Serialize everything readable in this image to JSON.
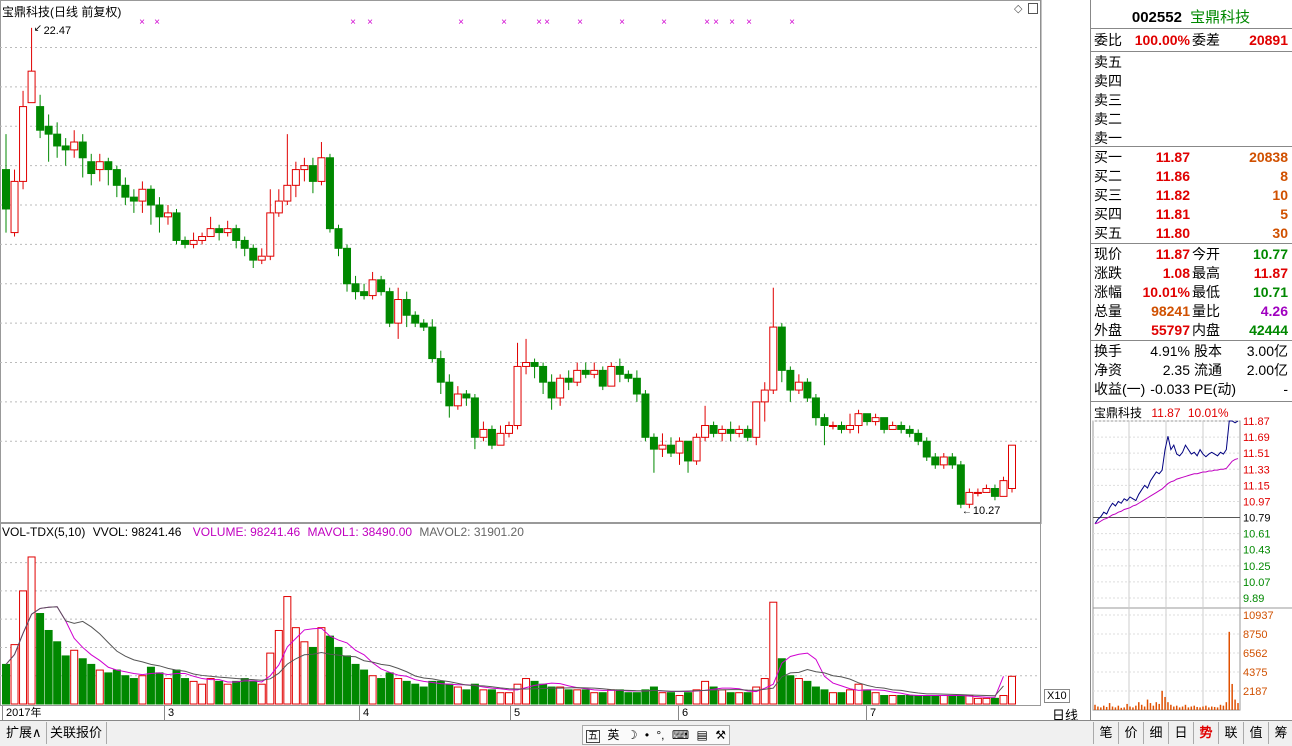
{
  "chart_header": {
    "title": "宝鼎科技(日线 前复权)",
    "high_label": "22.47",
    "low_label": "10.27"
  },
  "vol_header": {
    "name": "VOL-TDX(5,10)",
    "vvol": "VVOL: 98241.46",
    "volume": "VOLUME: 98241.46",
    "mavol1": "MAVOL1: 38490.00",
    "mavol2": "MAVOL2: 31901.20"
  },
  "axis": {
    "price_ticks": [
      "22.00",
      "21.00",
      "20.00",
      "19.00",
      "18.00",
      "17.00",
      "16.00",
      "15.00",
      "14.00",
      "13.00",
      "12.00"
    ],
    "vol_ticks": [
      "50000",
      "40000",
      "30000",
      "20000",
      "10000"
    ],
    "vol_unit": "X10",
    "dates": [
      "2017年",
      "3",
      "4",
      "5",
      "6",
      "7"
    ],
    "period": "日线"
  },
  "chart_data": {
    "type": "candlestick",
    "ylim": [
      10.0,
      22.75
    ],
    "volume_ylim": [
      0,
      58000
    ],
    "candles": [
      [
        18.9,
        17.9,
        19.8,
        17.3,
        14000
      ],
      [
        17.3,
        18.6,
        18.9,
        17.2,
        21000
      ],
      [
        18.6,
        20.5,
        20.9,
        18.4,
        40000
      ],
      [
        20.6,
        21.4,
        22.5,
        20.7,
        52000
      ],
      [
        20.5,
        19.9,
        20.8,
        19.7,
        32000
      ],
      [
        20.0,
        19.8,
        20.3,
        19.1,
        26000
      ],
      [
        19.8,
        19.5,
        20.1,
        19.2,
        22000
      ],
      [
        19.5,
        19.4,
        19.7,
        19.0,
        17000
      ],
      [
        19.4,
        19.6,
        19.9,
        19.2,
        19000
      ],
      [
        19.6,
        19.2,
        19.8,
        18.7,
        16000
      ],
      [
        19.1,
        18.8,
        19.3,
        18.5,
        14000
      ],
      [
        18.9,
        19.1,
        19.3,
        18.6,
        12000
      ],
      [
        19.1,
        18.9,
        19.2,
        18.5,
        11000
      ],
      [
        18.9,
        18.5,
        19.0,
        18.2,
        12000
      ],
      [
        18.5,
        18.2,
        18.7,
        18.0,
        10000
      ],
      [
        18.2,
        18.1,
        18.4,
        17.8,
        9000
      ],
      [
        18.1,
        18.4,
        18.6,
        17.8,
        10000
      ],
      [
        18.4,
        18.0,
        18.5,
        17.5,
        13000
      ],
      [
        18.0,
        17.7,
        18.2,
        17.3,
        11000
      ],
      [
        17.7,
        17.8,
        18.0,
        17.5,
        9000
      ],
      [
        17.8,
        17.1,
        17.9,
        17.0,
        12000
      ],
      [
        17.1,
        17.0,
        17.2,
        16.9,
        9000
      ],
      [
        17.0,
        17.1,
        17.3,
        16.9,
        8000
      ],
      [
        17.1,
        17.2,
        17.3,
        17.0,
        7000
      ],
      [
        17.2,
        17.4,
        17.7,
        17.2,
        9000
      ],
      [
        17.4,
        17.3,
        17.5,
        17.1,
        8000
      ],
      [
        17.3,
        17.4,
        17.6,
        17.2,
        7000
      ],
      [
        17.4,
        17.1,
        17.5,
        16.9,
        8000
      ],
      [
        17.1,
        16.9,
        17.2,
        16.7,
        9000
      ],
      [
        16.9,
        16.6,
        17.0,
        16.4,
        8000
      ],
      [
        16.6,
        16.7,
        16.9,
        16.5,
        7000
      ],
      [
        16.7,
        17.8,
        18.4,
        16.6,
        18000
      ],
      [
        17.8,
        18.1,
        18.4,
        17.7,
        26000
      ],
      [
        18.1,
        18.5,
        19.8,
        18.0,
        38000
      ],
      [
        18.5,
        18.9,
        19.1,
        18.2,
        27000
      ],
      [
        18.9,
        19.0,
        19.2,
        18.6,
        22000
      ],
      [
        19.0,
        18.6,
        19.2,
        18.3,
        20000
      ],
      [
        18.6,
        19.2,
        19.6,
        18.5,
        27000
      ],
      [
        19.2,
        17.4,
        19.3,
        17.3,
        24000
      ],
      [
        17.4,
        16.9,
        17.5,
        16.7,
        20000
      ],
      [
        16.9,
        16.0,
        17.0,
        15.8,
        17000
      ],
      [
        16.0,
        15.8,
        16.2,
        15.6,
        14000
      ],
      [
        15.8,
        15.7,
        16.0,
        15.6,
        12000
      ],
      [
        15.7,
        16.1,
        16.3,
        15.6,
        10000
      ],
      [
        16.1,
        15.8,
        16.2,
        15.7,
        9000
      ],
      [
        15.8,
        15.0,
        15.9,
        14.9,
        11000
      ],
      [
        15.0,
        15.6,
        15.9,
        14.6,
        9000
      ],
      [
        15.6,
        15.2,
        15.8,
        14.9,
        8000
      ],
      [
        15.2,
        15.0,
        15.3,
        14.9,
        7000
      ],
      [
        15.0,
        14.9,
        15.1,
        14.8,
        6000
      ],
      [
        14.9,
        14.1,
        15.1,
        14.0,
        8000
      ],
      [
        14.1,
        13.5,
        14.3,
        13.2,
        8000
      ],
      [
        13.5,
        12.9,
        13.7,
        12.6,
        7000
      ],
      [
        12.9,
        13.2,
        13.4,
        12.8,
        6000
      ],
      [
        13.2,
        13.1,
        13.3,
        12.9,
        5000
      ],
      [
        13.1,
        12.1,
        13.2,
        11.8,
        7000
      ],
      [
        12.1,
        12.3,
        12.5,
        12.0,
        5000
      ],
      [
        12.3,
        11.9,
        12.4,
        11.8,
        5000
      ],
      [
        11.9,
        12.2,
        12.4,
        11.9,
        4000
      ],
      [
        12.2,
        12.4,
        12.5,
        12.1,
        4000
      ],
      [
        12.4,
        13.9,
        14.5,
        12.3,
        7000
      ],
      [
        13.9,
        14.0,
        14.6,
        13.7,
        9000
      ],
      [
        14.0,
        13.9,
        14.1,
        13.6,
        8000
      ],
      [
        13.9,
        13.5,
        14.0,
        13.2,
        7000
      ],
      [
        13.5,
        13.1,
        13.7,
        12.8,
        6000
      ],
      [
        13.1,
        13.6,
        13.7,
        12.9,
        6000
      ],
      [
        13.6,
        13.5,
        13.8,
        13.3,
        5000
      ],
      [
        13.5,
        13.8,
        14.0,
        13.4,
        5000
      ],
      [
        13.8,
        13.7,
        14.0,
        13.6,
        5000
      ],
      [
        13.7,
        13.8,
        14.0,
        13.6,
        4000
      ],
      [
        13.8,
        13.4,
        13.9,
        13.3,
        4000
      ],
      [
        13.4,
        13.9,
        14.0,
        13.4,
        5000
      ],
      [
        13.9,
        13.7,
        14.1,
        13.5,
        5000
      ],
      [
        13.7,
        13.6,
        13.8,
        13.5,
        4000
      ],
      [
        13.6,
        13.2,
        13.8,
        13.0,
        4000
      ],
      [
        13.2,
        12.1,
        13.3,
        12.0,
        5000
      ],
      [
        12.1,
        11.8,
        12.2,
        11.2,
        6000
      ],
      [
        11.8,
        11.9,
        12.2,
        11.6,
        4000
      ],
      [
        11.9,
        11.7,
        12.1,
        11.6,
        4000
      ],
      [
        11.7,
        12.0,
        12.1,
        11.4,
        3000
      ],
      [
        12.0,
        11.5,
        12.0,
        11.2,
        4000
      ],
      [
        11.5,
        12.1,
        12.2,
        11.4,
        5000
      ],
      [
        12.1,
        12.4,
        12.9,
        12.0,
        8000
      ],
      [
        12.4,
        12.2,
        12.5,
        12.1,
        6000
      ],
      [
        12.2,
        12.3,
        12.4,
        12.0,
        5000
      ],
      [
        12.3,
        12.2,
        12.5,
        12.0,
        4000
      ],
      [
        12.2,
        12.3,
        12.4,
        12.1,
        4000
      ],
      [
        12.3,
        12.1,
        12.4,
        12.0,
        4000
      ],
      [
        12.1,
        13.0,
        13.0,
        11.9,
        6000
      ],
      [
        13.0,
        13.3,
        13.5,
        12.5,
        9000
      ],
      [
        13.3,
        14.9,
        15.9,
        13.2,
        36000
      ],
      [
        14.9,
        13.8,
        15.0,
        13.5,
        16000
      ],
      [
        13.8,
        13.3,
        13.9,
        13.0,
        10000
      ],
      [
        13.3,
        13.5,
        13.7,
        13.2,
        9000
      ],
      [
        13.5,
        13.1,
        13.6,
        13.0,
        8000
      ],
      [
        13.1,
        12.6,
        13.2,
        12.4,
        6000
      ],
      [
        12.6,
        12.4,
        12.7,
        11.9,
        5000
      ],
      [
        12.4,
        12.4,
        12.5,
        12.3,
        4000
      ],
      [
        12.4,
        12.3,
        12.5,
        12.2,
        4000
      ],
      [
        12.3,
        12.4,
        12.7,
        12.2,
        5000
      ],
      [
        12.4,
        12.7,
        12.8,
        12.2,
        7000
      ],
      [
        12.7,
        12.5,
        12.7,
        12.4,
        5000
      ],
      [
        12.5,
        12.6,
        12.7,
        12.4,
        4000
      ],
      [
        12.6,
        12.3,
        12.6,
        12.2,
        3000
      ],
      [
        12.3,
        12.4,
        12.5,
        12.3,
        3000
      ],
      [
        12.4,
        12.3,
        12.5,
        12.2,
        3000
      ],
      [
        12.3,
        12.2,
        12.4,
        12.1,
        3000
      ],
      [
        12.2,
        12.0,
        12.3,
        11.9,
        3000
      ],
      [
        12.0,
        11.6,
        12.1,
        11.5,
        3000
      ],
      [
        11.6,
        11.4,
        11.7,
        11.3,
        3000
      ],
      [
        11.4,
        11.6,
        11.7,
        11.3,
        3000
      ],
      [
        11.6,
        11.4,
        11.7,
        11.3,
        3000
      ],
      [
        11.4,
        10.4,
        11.5,
        10.3,
        3000
      ],
      [
        10.4,
        10.7,
        10.8,
        10.3,
        3000
      ],
      [
        10.7,
        10.7,
        10.8,
        10.6,
        2000
      ],
      [
        10.7,
        10.8,
        10.9,
        10.7,
        2000
      ],
      [
        10.8,
        10.6,
        10.9,
        10.5,
        2000
      ],
      [
        10.6,
        11.0,
        11.1,
        10.6,
        3000
      ],
      [
        10.8,
        11.9,
        11.9,
        10.7,
        9800
      ]
    ],
    "mavol1": [
      14000,
      17500,
      25000,
      31750,
      33800,
      34200,
      34400,
      29400,
      23200,
      20000,
      17400,
      15400,
      13000,
      12000,
      11400,
      10800,
      10400,
      10800,
      11000,
      10400,
      10800,
      10800,
      9800,
      9000,
      8600,
      8600,
      7800,
      7800,
      8200,
      8200,
      7800,
      10000,
      13800,
      20200,
      23200,
      26200,
      26600,
      26800,
      24000,
      22600,
      21600,
      19000,
      17400,
      14600,
      12400,
      11200,
      10200,
      9800,
      8600,
      8000,
      7600,
      7200,
      7000,
      6800,
      6800,
      6600,
      6000,
      5600,
      5400,
      5000,
      5000,
      5800,
      6600,
      7000,
      7400,
      7200,
      6400,
      5800,
      5400,
      5000,
      4800,
      4800,
      4800,
      4600,
      4600,
      4600,
      4800,
      4600,
      4400,
      4400,
      4400,
      4600,
      4800,
      5200,
      5600,
      5600,
      5400,
      4600,
      4400,
      5600,
      7000,
      14400,
      16800,
      17600,
      18000,
      15800,
      9800,
      7400,
      6400,
      5400,
      4800,
      5000,
      5000,
      4800,
      4200,
      3800,
      3200,
      3000,
      3000,
      3000,
      3000,
      3000,
      3000,
      2800,
      2600,
      2400,
      2400,
      9800
    ],
    "mavol2": [
      14000,
      17500,
      25000,
      31750,
      33800,
      34200,
      34400,
      29400,
      28500,
      29200,
      27300,
      24800,
      21700,
      18700,
      16900,
      15600,
      14900,
      14000,
      13500,
      12600,
      12000,
      11600,
      10600,
      10100,
      9800,
      9500,
      9300,
      9000,
      8800,
      8600,
      8400,
      8900,
      10900,
      14100,
      16000,
      17400,
      17600,
      18200,
      17600,
      17300,
      16900,
      16700,
      15300,
      14800,
      14000,
      13600,
      12600,
      11400,
      9900,
      9200,
      8900,
      8300,
      7900,
      7300,
      6700,
      6500,
      6400,
      6100,
      5700,
      5400,
      5300,
      5300,
      5400,
      5500,
      5600,
      5600,
      5700,
      5800,
      5700,
      5600,
      5400,
      5100,
      4900,
      4800,
      4700,
      4700,
      4800,
      4700,
      4500,
      4500,
      4600,
      4700,
      4800,
      4900,
      5000,
      5100,
      5100,
      4900,
      4800,
      5200,
      5600,
      9600,
      11000,
      11200,
      12200,
      11400,
      11000,
      10000,
      9600,
      8800,
      7500,
      6600,
      5900,
      5600,
      5000,
      4800,
      4300,
      3900,
      3600,
      3600,
      3500,
      3400,
      3300,
      3200,
      3100,
      3000,
      2900,
      6400
    ]
  },
  "marks_x": [
    142,
    157,
    353,
    370,
    461,
    504,
    539,
    547,
    580,
    622,
    664,
    707,
    716,
    732,
    749,
    792
  ],
  "right_panel": {
    "code": "002552",
    "name": "宝鼎科技",
    "weibi_label": "委比",
    "weibi_value": "100.00%",
    "weicha_label": "委差",
    "weicha_value": "20891",
    "sells": [
      {
        "label": "卖五",
        "price": "",
        "vol": ""
      },
      {
        "label": "卖四",
        "price": "",
        "vol": ""
      },
      {
        "label": "卖三",
        "price": "",
        "vol": ""
      },
      {
        "label": "卖二",
        "price": "",
        "vol": ""
      },
      {
        "label": "卖一",
        "price": "",
        "vol": ""
      }
    ],
    "buys": [
      {
        "label": "买一",
        "price": "11.87",
        "vol": "20838"
      },
      {
        "label": "买二",
        "price": "11.86",
        "vol": "8"
      },
      {
        "label": "买三",
        "price": "11.82",
        "vol": "10"
      },
      {
        "label": "买四",
        "price": "11.81",
        "vol": "5"
      },
      {
        "label": "买五",
        "price": "11.80",
        "vol": "30"
      }
    ],
    "stats": [
      {
        "l1": "现价",
        "v1": "11.87",
        "c1": "red",
        "l2": "今开",
        "v2": "10.77",
        "c2": "green"
      },
      {
        "l1": "涨跌",
        "v1": "1.08",
        "c1": "red",
        "l2": "最高",
        "v2": "11.87",
        "c2": "red"
      },
      {
        "l1": "涨幅",
        "v1": "10.01%",
        "c1": "red",
        "l2": "最低",
        "v2": "10.71",
        "c2": "green"
      },
      {
        "l1": "总量",
        "v1": "98241",
        "c1": "orange",
        "l2": "量比",
        "v2": "4.26",
        "c2": "purple"
      },
      {
        "l1": "外盘",
        "v1": "55797",
        "c1": "red",
        "l2": "内盘",
        "v2": "42444",
        "c2": "green"
      }
    ],
    "fund": [
      {
        "l1": "换手",
        "v1": "4.91%",
        "l2": "股本",
        "v2": "3.00亿"
      },
      {
        "l1": "净资",
        "v1": "2.35",
        "l2": "流通",
        "v2": "2.00亿"
      },
      {
        "l1": "收益(一)",
        "v1": "-0.033",
        "l2": "PE(动)",
        "v2": "-"
      }
    ]
  },
  "intraday": {
    "name": "宝鼎科技",
    "price": "11.87",
    "pct": "10.01%",
    "price_ticks": [
      "11.87",
      "11.69",
      "11.51",
      "11.33",
      "11.15",
      "10.97",
      "10.79",
      "10.61",
      "10.43",
      "10.25",
      "10.07",
      "9.89"
    ],
    "vol_ticks": [
      "10937",
      "8750",
      "6562",
      "4375",
      "2187"
    ],
    "prices": [
      10.72,
      10.77,
      10.8,
      10.85,
      10.83,
      10.9,
      10.95,
      10.92,
      10.97,
      10.95,
      11.0,
      10.98,
      11.02,
      11.0,
      10.98,
      11.05,
      11.1,
      11.15,
      11.12,
      11.2,
      11.25,
      11.3,
      11.28,
      11.32,
      11.55,
      11.7,
      11.55,
      11.6,
      11.5,
      11.48,
      11.52,
      11.6,
      11.55,
      11.5,
      11.52,
      11.48,
      11.55,
      11.5,
      11.47,
      11.5,
      11.52,
      11.5,
      11.48,
      11.52,
      11.5,
      11.55,
      11.87,
      11.87,
      11.85,
      11.87
    ],
    "avg": [
      10.72,
      10.73,
      10.75,
      10.77,
      10.78,
      10.8,
      10.82,
      10.83,
      10.85,
      10.86,
      10.88,
      10.89,
      10.9,
      10.92,
      10.93,
      10.95,
      10.97,
      10.99,
      11.01,
      11.03,
      11.05,
      11.07,
      11.09,
      11.11,
      11.14,
      11.17,
      11.19,
      11.2,
      11.22,
      11.23,
      11.24,
      11.25,
      11.26,
      11.27,
      11.28,
      11.28,
      11.29,
      11.3,
      11.3,
      11.31,
      11.31,
      11.32,
      11.32,
      11.33,
      11.33,
      11.34,
      11.38,
      11.42,
      11.44,
      11.45
    ],
    "vols": [
      600,
      400,
      300,
      500,
      350,
      800,
      400,
      300,
      500,
      250,
      300,
      700,
      400,
      300,
      500,
      900,
      600,
      400,
      1200,
      800,
      500,
      900,
      700,
      2200,
      1500,
      900,
      600,
      400,
      500,
      300,
      400,
      600,
      300,
      400,
      500,
      350,
      300,
      400,
      500,
      300,
      400,
      350,
      300,
      600,
      500,
      900,
      9000,
      3000,
      1200,
      800
    ]
  },
  "bottom_tabs": {
    "left": [
      "扩展∧",
      "关联报价"
    ],
    "right": [
      "笔",
      "价",
      "细",
      "日",
      "势",
      "联",
      "值",
      "筹"
    ]
  }
}
